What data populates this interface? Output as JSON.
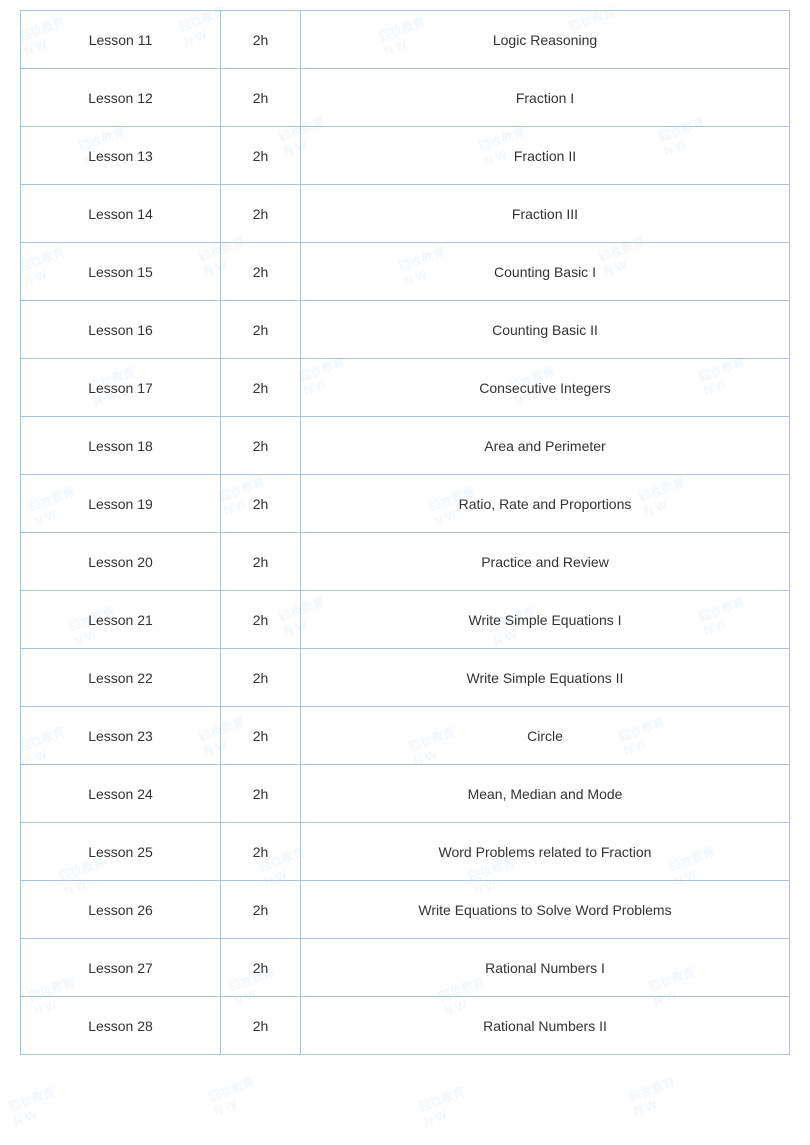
{
  "table": {
    "rows": [
      {
        "lesson": "Lesson 11",
        "duration": "2h",
        "topic": "Logic Reasoning"
      },
      {
        "lesson": "Lesson 12",
        "duration": "2h",
        "topic": "Fraction I"
      },
      {
        "lesson": "Lesson 13",
        "duration": "2h",
        "topic": "Fraction II"
      },
      {
        "lesson": "Lesson 14",
        "duration": "2h",
        "topic": "Fraction III"
      },
      {
        "lesson": "Lesson 15",
        "duration": "2h",
        "topic": "Counting Basic I"
      },
      {
        "lesson": "Lesson 16",
        "duration": "2h",
        "topic": "Counting Basic II"
      },
      {
        "lesson": "Lesson 17",
        "duration": "2h",
        "topic": "Consecutive Integers"
      },
      {
        "lesson": "Lesson 18",
        "duration": "2h",
        "topic": "Area and Perimeter"
      },
      {
        "lesson": "Lesson 19",
        "duration": "2h",
        "topic": "Ratio, Rate and Proportions"
      },
      {
        "lesson": "Lesson 20",
        "duration": "2h",
        "topic": "Practice and Review"
      },
      {
        "lesson": "Lesson 21",
        "duration": "2h",
        "topic": "Write Simple Equations I"
      },
      {
        "lesson": "Lesson 22",
        "duration": "2h",
        "topic": "Write Simple Equations II"
      },
      {
        "lesson": "Lesson 23",
        "duration": "2h",
        "topic": "Circle"
      },
      {
        "lesson": "Lesson 24",
        "duration": "2h",
        "topic": "Mean, Median and Mode"
      },
      {
        "lesson": "Lesson 25",
        "duration": "2h",
        "topic": "Word Problems related to Fraction"
      },
      {
        "lesson": "Lesson 26",
        "duration": "2h",
        "topic": "Write Equations to Solve Word Problems"
      },
      {
        "lesson": "Lesson 27",
        "duration": "2h",
        "topic": "Rational Numbers I"
      },
      {
        "lesson": "Lesson 28",
        "duration": "2h",
        "topic": "Rational Numbers II"
      }
    ]
  }
}
